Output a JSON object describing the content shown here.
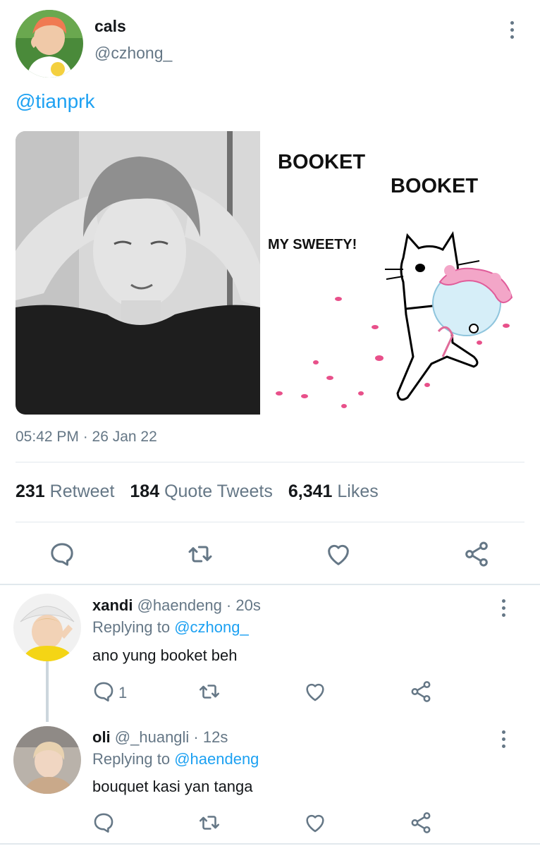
{
  "tweet": {
    "author_name": "cals",
    "author_handle": "@czhong_",
    "text": "@tianprk",
    "meme_text_1": "BOOKET",
    "meme_text_2": "BOOKET",
    "meme_text_3": "MY SWEETY!",
    "timestamp": "05:42 PM · 26 Jan 22",
    "stats": {
      "retweets_count": "231",
      "retweets_label": "Retweet",
      "quotes_count": "184",
      "quotes_label": "Quote Tweets",
      "likes_count": "6,341",
      "likes_label": "Likes"
    }
  },
  "replies": [
    {
      "name": "xandi",
      "handle_time": "@haendeng · 20s",
      "replying_label": "Replying to",
      "replying_to": "@czhong_",
      "text": "ano yung booket beh",
      "reply_count": "1"
    },
    {
      "name": "oli",
      "handle_time": "@_huangli · 12s",
      "replying_label": "Replying to",
      "replying_to": "@haendeng",
      "text": "bouquet kasi yan tanga",
      "reply_count": ""
    }
  ],
  "icons": {
    "reply": "reply-icon",
    "retweet": "retweet-icon",
    "like": "heart-icon",
    "share": "share-icon",
    "more": "more-icon"
  },
  "colors": {
    "link": "#1da1f2",
    "secondary_text": "#657786",
    "divider": "#e1e8ed"
  }
}
